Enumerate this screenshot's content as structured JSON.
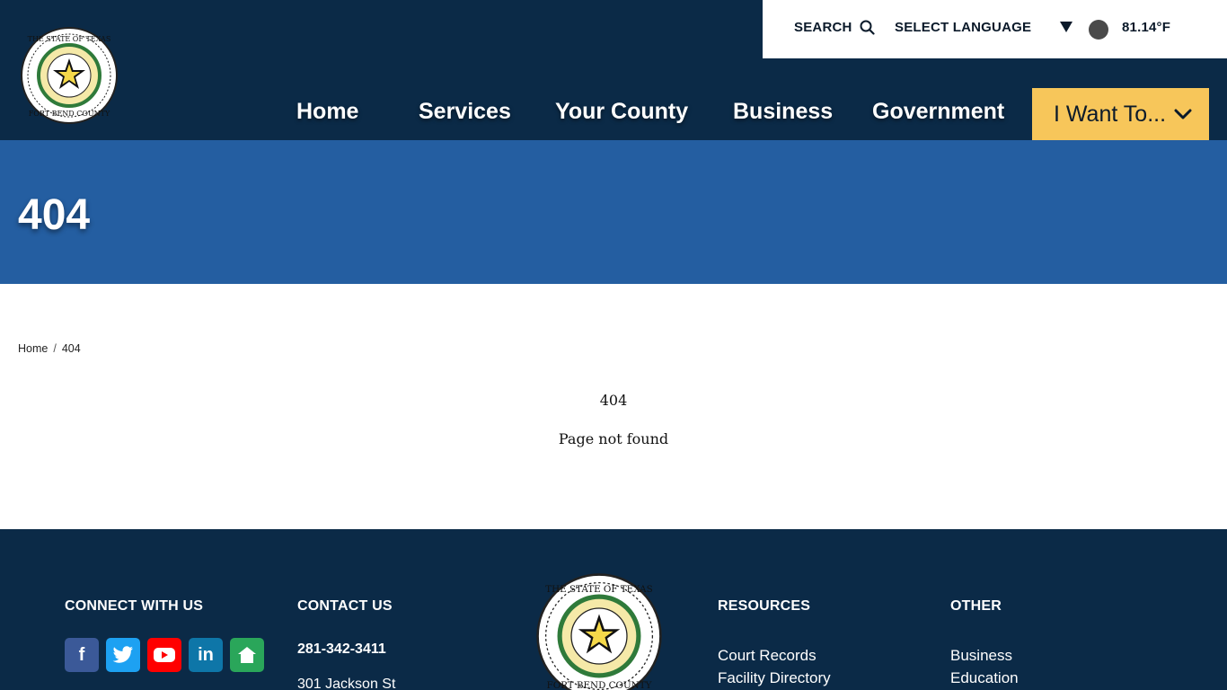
{
  "header": {
    "utility": {
      "search_label": "SEARCH",
      "language_label": "SELECT LANGUAGE",
      "temperature": "81.14°F"
    },
    "nav": {
      "home": "Home",
      "services": "Services",
      "your_county": "Your County",
      "business": "Business",
      "government": "Government",
      "i_want_to": "I Want To..."
    }
  },
  "hero": {
    "title": "404"
  },
  "breadcrumb": {
    "home": "Home",
    "separator": "/",
    "current": "404"
  },
  "content": {
    "code": "404",
    "message": "Page not found"
  },
  "footer": {
    "connect_heading": "CONNECT WITH US",
    "contact_heading": "CONTACT US",
    "phone": "281-342-3411",
    "address": "301 Jackson St",
    "resources_heading": "RESOURCES",
    "resources_links": [
      "Court Records",
      "Facility Directory"
    ],
    "other_heading": "OTHER",
    "other_links": [
      "Business",
      "Education"
    ]
  },
  "colors": {
    "navy": "#0b2a47",
    "hero_blue": "#245ea1",
    "accent_yellow": "#f7c65a"
  },
  "icons": [
    "county-seal-icon",
    "search-icon",
    "caret-down-icon",
    "weather-icon",
    "chevron-down-icon",
    "facebook-icon",
    "twitter-icon",
    "youtube-icon",
    "linkedin-icon",
    "nextdoor-icon"
  ]
}
